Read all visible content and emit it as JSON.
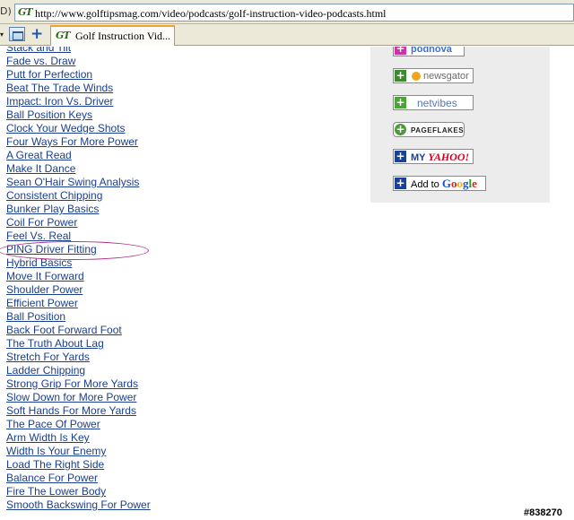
{
  "addressbar": {
    "prefix": "D)",
    "site_icon": "GT",
    "url": "http://www.golftipsmag.com/video/podcasts/golf-instruction-video-podcasts.html"
  },
  "tabbar": {
    "arrow": "▾",
    "add_button": "+",
    "active_tab": {
      "icon": "GT",
      "label": "Golf Instruction Vid..."
    }
  },
  "video_links": [
    "Stack and Tilt",
    "Fade vs. Draw",
    "Putt for Perfection",
    "Beat The Trade Winds",
    "Impact: Iron Vs. Driver",
    "Ball Position Keys",
    "Clock Your Wedge Shots",
    "Four Ways For More Power",
    "A Great Read",
    "Make It Dance",
    "Sean O'Hair Swing Analysis",
    "Consistent Chipping",
    "Bunker Play Basics",
    "Coil For Power",
    "Feel Vs. Real",
    "PING Driver Fitting",
    "Hybrid Basics",
    "Move It Forward",
    "Shoulder Power",
    "Efficient Power",
    "Ball Position",
    "Back Foot Forward Foot",
    "The Truth About Lag",
    "Stretch For Yards",
    "Ladder Chipping",
    "Strong Grip For More Yards",
    "Slow Down for More Power",
    "Soft Hands For More Yards",
    "The Pace Of Power",
    "Arm Width Is Key",
    "Width Is Your Enemy",
    "Load The Right Side",
    "Balance For Power",
    "Fire The Lower Body",
    "Smooth Backswing For Power"
  ],
  "subscribe": {
    "podnova": "podnova",
    "newsgator": "newsgator",
    "netvibes": "netvibes",
    "pageflakes": "PAGEFLAKES",
    "myyahoo_prefix": "MY",
    "myyahoo_brand": "YAHOO!",
    "google_prefix": "Add to",
    "google_brand": "Google"
  },
  "watermark": "#838270",
  "colors": {
    "link": "#1a3f8f",
    "panel": "#ececec",
    "highlight": "#b0308e"
  }
}
